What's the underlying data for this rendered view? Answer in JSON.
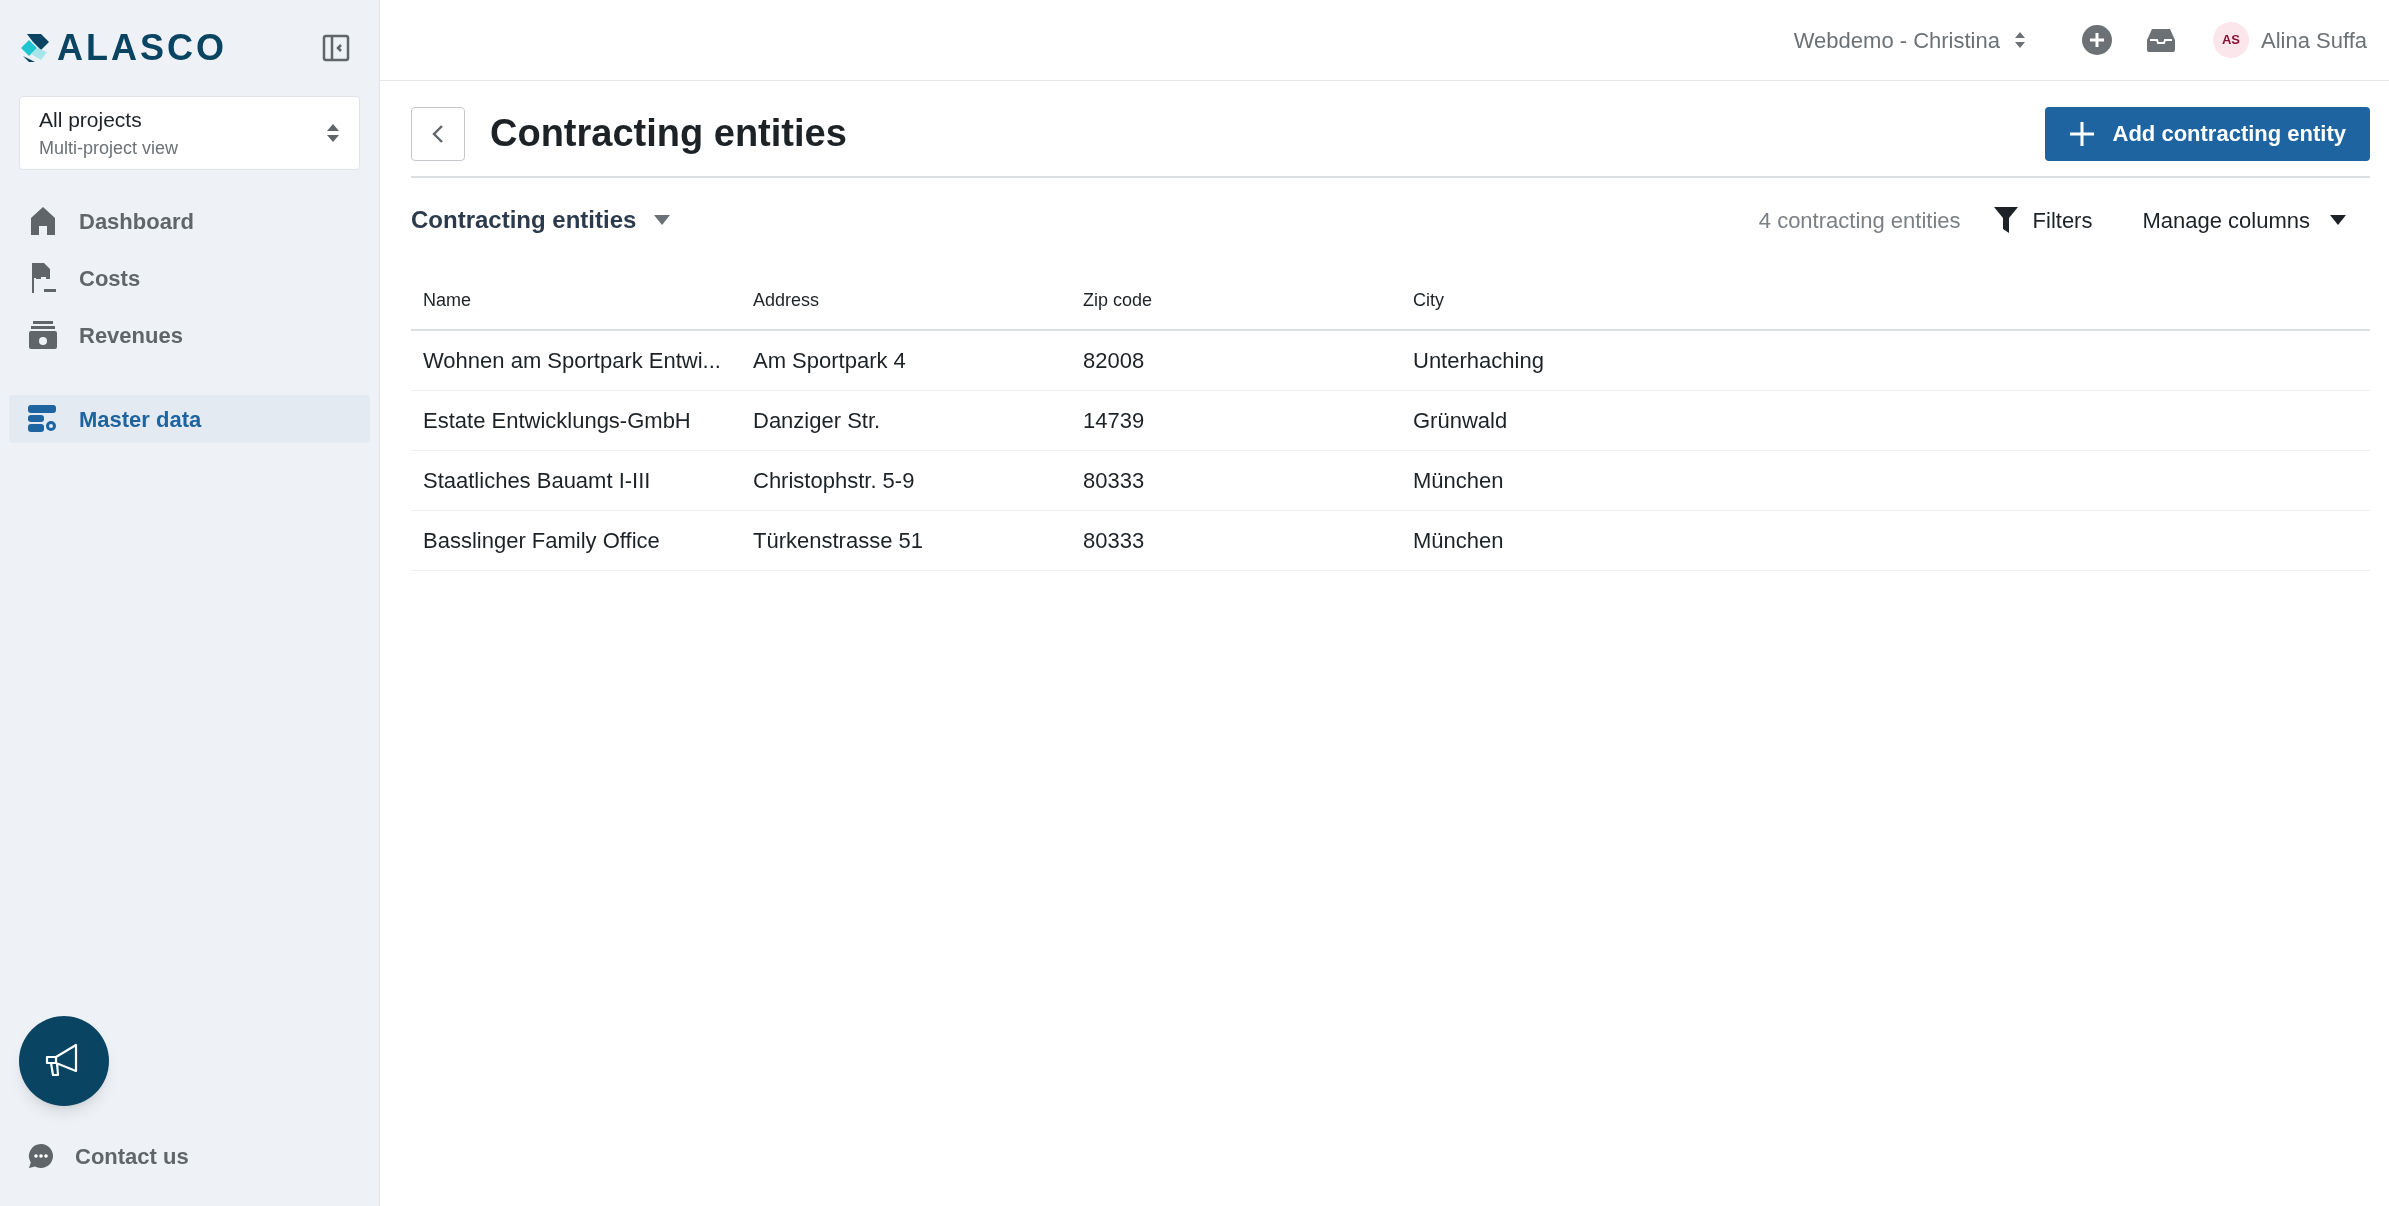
{
  "sidebar": {
    "logo": "ALASCO",
    "project_selector": {
      "title": "All projects",
      "subtitle": "Multi-project view"
    },
    "items": [
      {
        "label": "Dashboard",
        "selected": false
      },
      {
        "label": "Costs",
        "selected": false
      },
      {
        "label": "Revenues",
        "selected": false
      },
      {
        "label": "Master data",
        "selected": true
      }
    ],
    "contact": "Contact us"
  },
  "topbar": {
    "workspace": "Webdemo - Christina",
    "user_initials": "AS",
    "user_name": "Alina Suffa"
  },
  "page": {
    "title": "Contracting entities",
    "add_button": "Add contracting entity",
    "view": "Contracting entities",
    "count": "4 contracting entities",
    "filters": "Filters",
    "manage_columns": "Manage columns"
  },
  "table": {
    "columns": [
      "Name",
      "Address",
      "Zip code",
      "City"
    ],
    "rows": [
      [
        "Wohnen am Sportpark Entwi...",
        "Am Sportpark 4",
        "82008",
        "Unterhaching"
      ],
      [
        "Estate Entwicklungs-GmbH",
        "Danziger Str.",
        "14739",
        "Grünwald"
      ],
      [
        "Staatliches Bauamt I-III",
        "Christophstr. 5-9",
        "80333",
        "München"
      ],
      [
        "Basslinger Family Office",
        "Türkenstrasse 51",
        "80333",
        "München"
      ]
    ]
  }
}
